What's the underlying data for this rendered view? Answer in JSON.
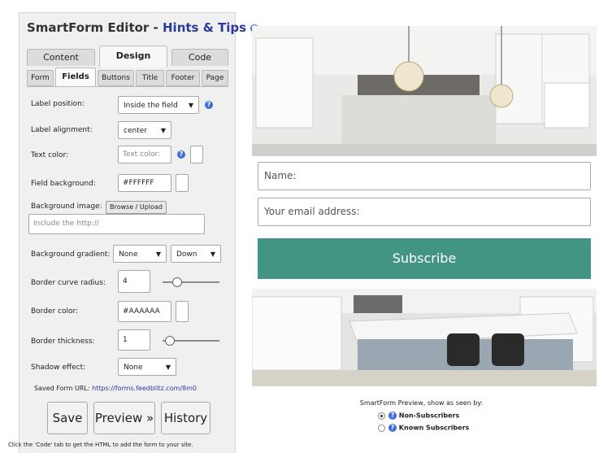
{
  "panel": {
    "title_main": "SmartForm Editor - ",
    "title_hint": "Hints & Tips",
    "help_icon": "question-circle-icon",
    "main_tabs": [
      {
        "label": "Content",
        "active": false
      },
      {
        "label": "Design",
        "active": true
      },
      {
        "label": "Code",
        "active": false
      }
    ],
    "sub_tabs": [
      {
        "label": "Form",
        "active": false
      },
      {
        "label": "Fields",
        "active": true
      },
      {
        "label": "Buttons",
        "active": false
      },
      {
        "label": "Title",
        "active": false
      },
      {
        "label": "Footer",
        "active": false
      },
      {
        "label": "Page",
        "active": false
      }
    ],
    "fields": {
      "label_position": {
        "label": "Label position:",
        "value": "Inside the field"
      },
      "label_alignment": {
        "label": "Label alignment:",
        "value": "center"
      },
      "text_color": {
        "label": "Text color:",
        "placeholder": "Text color:"
      },
      "field_background": {
        "label": "Field background:",
        "value": "#FFFFFF"
      },
      "background_image": {
        "label": "Background image:",
        "browse_label": "Browse / Upload",
        "placeholder": "Include the http://"
      },
      "background_gradient": {
        "label": "Background gradient:",
        "value": "None",
        "direction": "Down"
      },
      "border_curve_radius": {
        "label": "Border curve radius:",
        "value": "4",
        "slider_level": 0.2
      },
      "border_color": {
        "label": "Border color:",
        "value": "#AAAAAA"
      },
      "border_thickness": {
        "label": "Border thickness:",
        "value": "1",
        "slider_level": 0.05
      },
      "shadow_effect": {
        "label": "Shadow effect:",
        "value": "None"
      }
    },
    "saved_url_label": "Saved Form URL: ",
    "saved_url": "https://forms.feedblitz.com/8m0",
    "buttons": {
      "save": "Save",
      "preview": "Preview »",
      "history": "History"
    },
    "footnote": "Click the 'Code' tab to get the HTML to add the form to your site."
  },
  "preview": {
    "name_placeholder": "Name:",
    "email_placeholder": "Your email address:",
    "subscribe_label": "Subscribe",
    "subscribe_color": "#419582",
    "note": "SmartForm Preview, show as seen by:",
    "options": [
      {
        "label": "Non-Subscribers",
        "selected": true
      },
      {
        "label": "Known Subscribers",
        "selected": false
      }
    ]
  }
}
